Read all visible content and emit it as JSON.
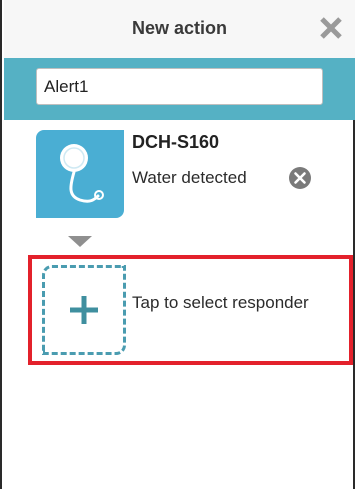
{
  "header": {
    "title": "New action"
  },
  "action_name": {
    "value": "Alert1"
  },
  "trigger": {
    "device_name": "DCH-S160",
    "event": "Water detected"
  },
  "responder": {
    "label": "Tap to select responder"
  },
  "icons": {
    "close": "close-x-icon",
    "remove": "circle-x-icon",
    "sensor": "water-sensor-icon",
    "add": "plus-icon",
    "arrow": "down-arrow-icon"
  },
  "colors": {
    "accent_bar": "#55b1c4",
    "device_tile": "#4aaed3",
    "dashed_border": "#4a9cb0",
    "highlight": "#e3212b"
  }
}
